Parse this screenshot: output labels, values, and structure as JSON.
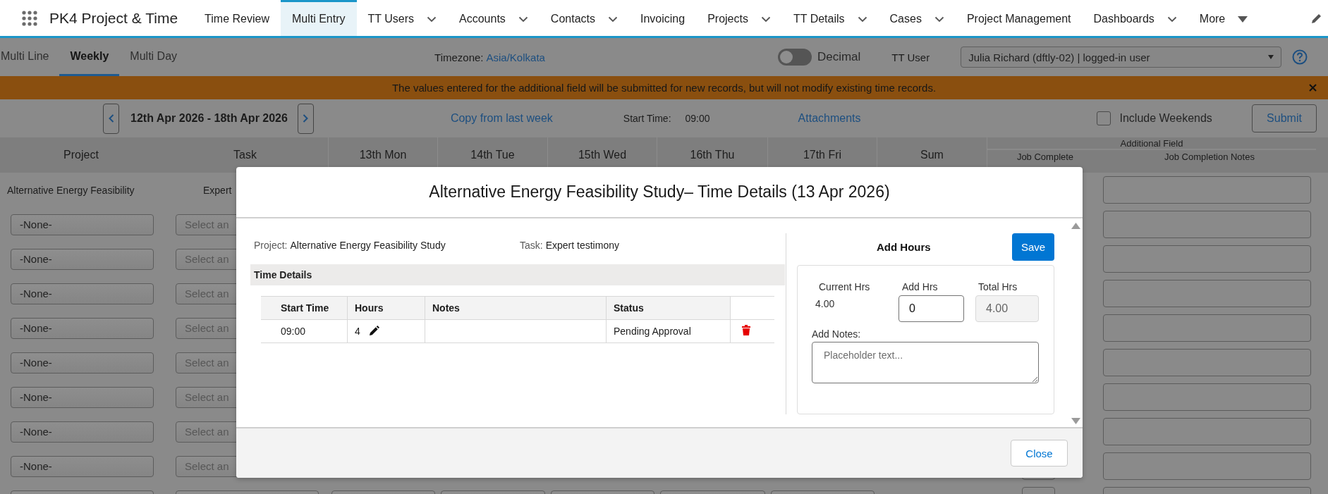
{
  "app": {
    "title": "PK4 Project & Time"
  },
  "nav_tabs": [
    {
      "label": "Time Review",
      "selected": false,
      "kind": "plain"
    },
    {
      "label": "Multi Entry",
      "selected": true,
      "kind": "plain"
    },
    {
      "label": "TT Users",
      "selected": false,
      "kind": "chevron"
    },
    {
      "label": "Accounts",
      "selected": false,
      "kind": "chevron"
    },
    {
      "label": "Contacts",
      "selected": false,
      "kind": "chevron"
    },
    {
      "label": "Invoicing",
      "selected": false,
      "kind": "plain"
    },
    {
      "label": "Projects",
      "selected": false,
      "kind": "chevron"
    },
    {
      "label": "TT Details",
      "selected": false,
      "kind": "chevron"
    },
    {
      "label": "Cases",
      "selected": false,
      "kind": "chevron"
    },
    {
      "label": "Project Management",
      "selected": false,
      "kind": "plain"
    },
    {
      "label": "Dashboards",
      "selected": false,
      "kind": "chevron"
    },
    {
      "label": "More",
      "selected": false,
      "kind": "triangle"
    }
  ],
  "view_tabs": [
    {
      "label": "Multi Line",
      "selected": false
    },
    {
      "label": "Weekly",
      "selected": true
    },
    {
      "label": "Multi Day",
      "selected": false
    }
  ],
  "timezone": {
    "label": "Timezone:",
    "value": "Asia/Kolkata"
  },
  "decimal_toggle": {
    "label": "Decimal",
    "on": false
  },
  "tt_user": {
    "label": "TT User",
    "value": "Julia Richard (dftly-02) | logged-in user"
  },
  "banner": {
    "message": "The values entered for the additional field will be submitted for new records, but will not modify existing time records."
  },
  "week": {
    "range": "12th Apr 2026 - 18th Apr 2026"
  },
  "copy_link": "Copy from last week",
  "start_time": {
    "label": "Start Time:",
    "value": "09:00"
  },
  "attachments_link": "Attachments",
  "include_weekends": {
    "label": "Include Weekends",
    "checked": false
  },
  "submit_button": "Submit",
  "grid": {
    "columns": [
      "Project",
      "Task",
      "13th Mon",
      "14th Tue",
      "15th Wed",
      "16th Thu",
      "17th Fri",
      "Sum"
    ],
    "additional_field": {
      "title": "Additional Field",
      "columns": [
        "Job Complete",
        "Job Completion Notes"
      ]
    },
    "rows": [
      {
        "kind": "text",
        "project": "Alternative Energy Feasibility",
        "task": "Expert"
      },
      {
        "kind": "select",
        "project": "-None-",
        "task_placeholder": "Select an"
      },
      {
        "kind": "select",
        "project": "-None-",
        "task_placeholder": "Select an"
      },
      {
        "kind": "select",
        "project": "-None-",
        "task_placeholder": "Select an"
      },
      {
        "kind": "select",
        "project": "-None-",
        "task_placeholder": "Select an"
      },
      {
        "kind": "select",
        "project": "-None-",
        "task_placeholder": "Select an"
      },
      {
        "kind": "select",
        "project": "-None-",
        "task_placeholder": "Select an"
      },
      {
        "kind": "select",
        "project": "-None-",
        "task_placeholder": "Select an"
      },
      {
        "kind": "select",
        "project": "-None-",
        "task_placeholder": "Select an"
      },
      {
        "kind": "empty"
      }
    ]
  },
  "modal": {
    "title": "Alternative Energy Feasibility Study– Time Details (13 Apr 2026)",
    "project": {
      "label": "Project:",
      "value": "Alternative Energy Feasibility Study"
    },
    "task": {
      "label": "Task:",
      "value": "Expert testimony"
    },
    "section_title": "Time Details",
    "table": {
      "columns": [
        "Start Time",
        "Hours",
        "Notes",
        "Status"
      ],
      "rows": [
        {
          "start_time": "09:00",
          "hours": "4",
          "status": "Pending Approval"
        }
      ]
    },
    "add_hours": {
      "title": "Add Hours",
      "save_button": "Save",
      "current_hrs": {
        "label": "Current Hrs",
        "value": "4.00"
      },
      "add_hrs": {
        "label": "Add Hrs",
        "value": "0"
      },
      "total_hrs": {
        "label": "Total Hrs",
        "value": "4.00",
        "disabled": true
      },
      "notes": {
        "label": "Add Notes:",
        "placeholder": "Placeholder text..."
      }
    },
    "close_button": "Close"
  }
}
